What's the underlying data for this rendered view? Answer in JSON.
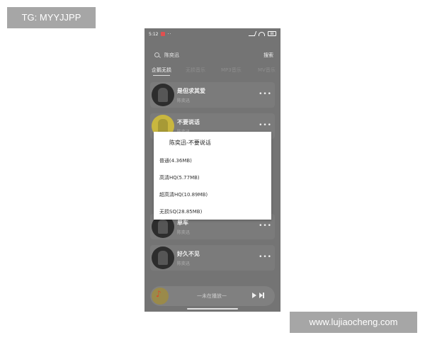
{
  "watermarks": {
    "top_left": "TG: MYYJJPP",
    "bottom_right": "www.lujiaocheng.com"
  },
  "status_bar": {
    "time": "5:12",
    "dots": "··",
    "battery": "88"
  },
  "search": {
    "query": "陈奕迅",
    "button_label": "搜索"
  },
  "tabs": [
    {
      "label": "企鹅无损",
      "active": true
    },
    {
      "label": "无损音乐",
      "active": false
    },
    {
      "label": "MP3音乐",
      "active": false
    },
    {
      "label": "MV音乐",
      "active": false
    }
  ],
  "songs": [
    {
      "title": "是但求其爱",
      "artist": "陈奕迅",
      "cover": "dark"
    },
    {
      "title": "不要说话",
      "artist": "陈奕迅",
      "cover": "yellow"
    },
    {
      "title": "单车",
      "artist": "陈奕迅",
      "cover": "dark"
    },
    {
      "title": "好久不见",
      "artist": "陈奕迅",
      "cover": "dark"
    }
  ],
  "player": {
    "status_text": "一未在播放一"
  },
  "dialog": {
    "title": "陈奕迅-不要说话",
    "options": [
      "普通(4.36MB)",
      "高清HQ(5.77MB)",
      "超高清HQ(10.89MB)",
      "无损SQ(28.85MB)"
    ]
  },
  "colors": {
    "overlay_background": "#747474",
    "dialog_background": "#ffffff",
    "watermark_background": "#a6a6a6"
  }
}
